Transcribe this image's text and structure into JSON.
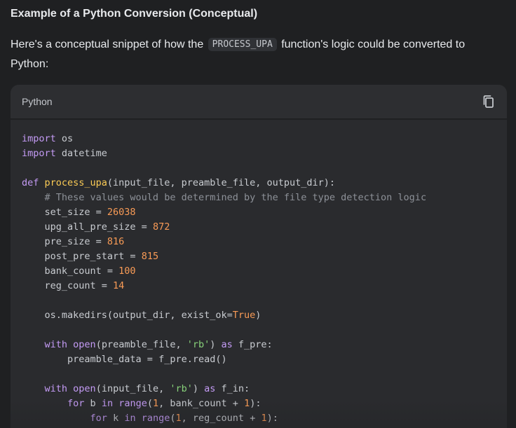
{
  "heading": "Example of a Python Conversion (Conceptual)",
  "intro": {
    "before": "Here's a conceptual snippet of how the ",
    "code": "PROCESS_UPA",
    "after": " function's logic could be converted to Python:"
  },
  "code_block": {
    "language": "Python",
    "copy_icon": "copy-icon",
    "lines": [
      [
        {
          "t": "import",
          "c": "kw"
        },
        {
          "t": " os",
          "c": ""
        }
      ],
      [
        {
          "t": "import",
          "c": "kw"
        },
        {
          "t": " datetime",
          "c": ""
        }
      ],
      [],
      [
        {
          "t": "def ",
          "c": "kw"
        },
        {
          "t": "process_upa",
          "c": "fn"
        },
        {
          "t": "(input_file, preamble_file, output_dir):",
          "c": ""
        }
      ],
      [
        {
          "t": "    # These values would be determined by the file type detection logic",
          "c": "cm"
        }
      ],
      [
        {
          "t": "    set_size = ",
          "c": ""
        },
        {
          "t": "26038",
          "c": "num"
        }
      ],
      [
        {
          "t": "    upg_all_pre_size = ",
          "c": ""
        },
        {
          "t": "872",
          "c": "num"
        }
      ],
      [
        {
          "t": "    pre_size = ",
          "c": ""
        },
        {
          "t": "816",
          "c": "num"
        }
      ],
      [
        {
          "t": "    post_pre_start = ",
          "c": ""
        },
        {
          "t": "815",
          "c": "num"
        }
      ],
      [
        {
          "t": "    bank_count = ",
          "c": ""
        },
        {
          "t": "100",
          "c": "num"
        }
      ],
      [
        {
          "t": "    reg_count = ",
          "c": ""
        },
        {
          "t": "14",
          "c": "num"
        }
      ],
      [],
      [
        {
          "t": "    os.makedirs(output_dir, exist_ok=",
          "c": ""
        },
        {
          "t": "True",
          "c": "num"
        },
        {
          "t": ")",
          "c": ""
        }
      ],
      [],
      [
        {
          "t": "    ",
          "c": ""
        },
        {
          "t": "with",
          "c": "kw"
        },
        {
          "t": " ",
          "c": ""
        },
        {
          "t": "open",
          "c": "bi"
        },
        {
          "t": "(preamble_file, ",
          "c": ""
        },
        {
          "t": "'rb'",
          "c": "str"
        },
        {
          "t": ") ",
          "c": ""
        },
        {
          "t": "as",
          "c": "kw"
        },
        {
          "t": " f_pre:",
          "c": ""
        }
      ],
      [
        {
          "t": "        preamble_data = f_pre.read()",
          "c": ""
        }
      ],
      [],
      [
        {
          "t": "    ",
          "c": ""
        },
        {
          "t": "with",
          "c": "kw"
        },
        {
          "t": " ",
          "c": ""
        },
        {
          "t": "open",
          "c": "bi"
        },
        {
          "t": "(input_file, ",
          "c": ""
        },
        {
          "t": "'rb'",
          "c": "str"
        },
        {
          "t": ") ",
          "c": ""
        },
        {
          "t": "as",
          "c": "kw"
        },
        {
          "t": " f_in:",
          "c": ""
        }
      ],
      [
        {
          "t": "        ",
          "c": ""
        },
        {
          "t": "for",
          "c": "kw"
        },
        {
          "t": " b ",
          "c": ""
        },
        {
          "t": "in",
          "c": "kw"
        },
        {
          "t": " ",
          "c": ""
        },
        {
          "t": "range",
          "c": "bi"
        },
        {
          "t": "(",
          "c": ""
        },
        {
          "t": "1",
          "c": "num"
        },
        {
          "t": ", bank_count + ",
          "c": ""
        },
        {
          "t": "1",
          "c": "num"
        },
        {
          "t": "):",
          "c": ""
        }
      ],
      [
        {
          "t": "            ",
          "c": ""
        },
        {
          "t": "for",
          "c": "kw"
        },
        {
          "t": " k ",
          "c": ""
        },
        {
          "t": "in",
          "c": "kw"
        },
        {
          "t": " ",
          "c": ""
        },
        {
          "t": "range",
          "c": "bi"
        },
        {
          "t": "(",
          "c": ""
        },
        {
          "t": "1",
          "c": "num"
        },
        {
          "t": ", reg_count + ",
          "c": ""
        },
        {
          "t": "1",
          "c": "num"
        },
        {
          "t": "):",
          "c": ""
        }
      ]
    ]
  }
}
